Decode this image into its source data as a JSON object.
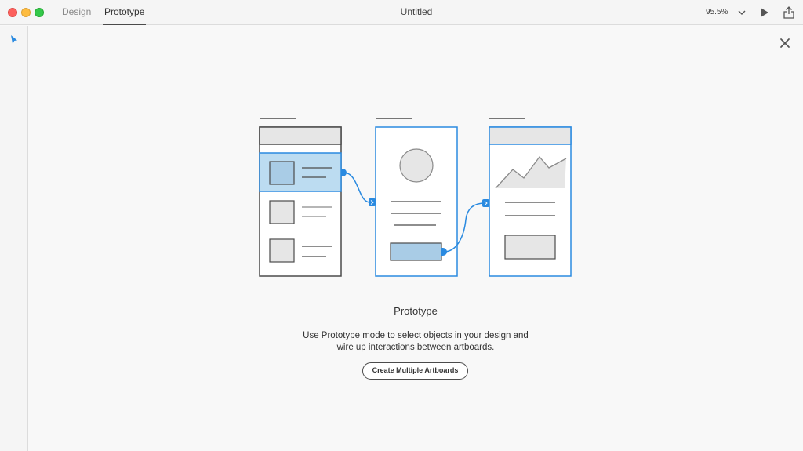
{
  "titlebar": {
    "tabs": [
      {
        "label": "Design",
        "active": false
      },
      {
        "label": "Prototype",
        "active": true
      }
    ],
    "document_title": "Untitled",
    "zoom_level": "95.5%",
    "icons": [
      "chevron-down-icon",
      "play-icon",
      "share-icon"
    ]
  },
  "sidebar": {
    "tools": [
      {
        "icon": "select-arrow-icon"
      }
    ]
  },
  "main": {
    "heading": "Prototype",
    "description_lines": [
      "Use Prototype mode to select objects in your design and",
      "wire up interactions between artboards."
    ],
    "cta_label": "Create Multiple Artboards",
    "close_icon": "close-icon"
  },
  "colors": {
    "accent": "#2a8ae0",
    "highlight_fill": "#bcdcf1",
    "wire_gray": "#4b4b4b",
    "placeholder_fill": "#e6e6e6"
  }
}
